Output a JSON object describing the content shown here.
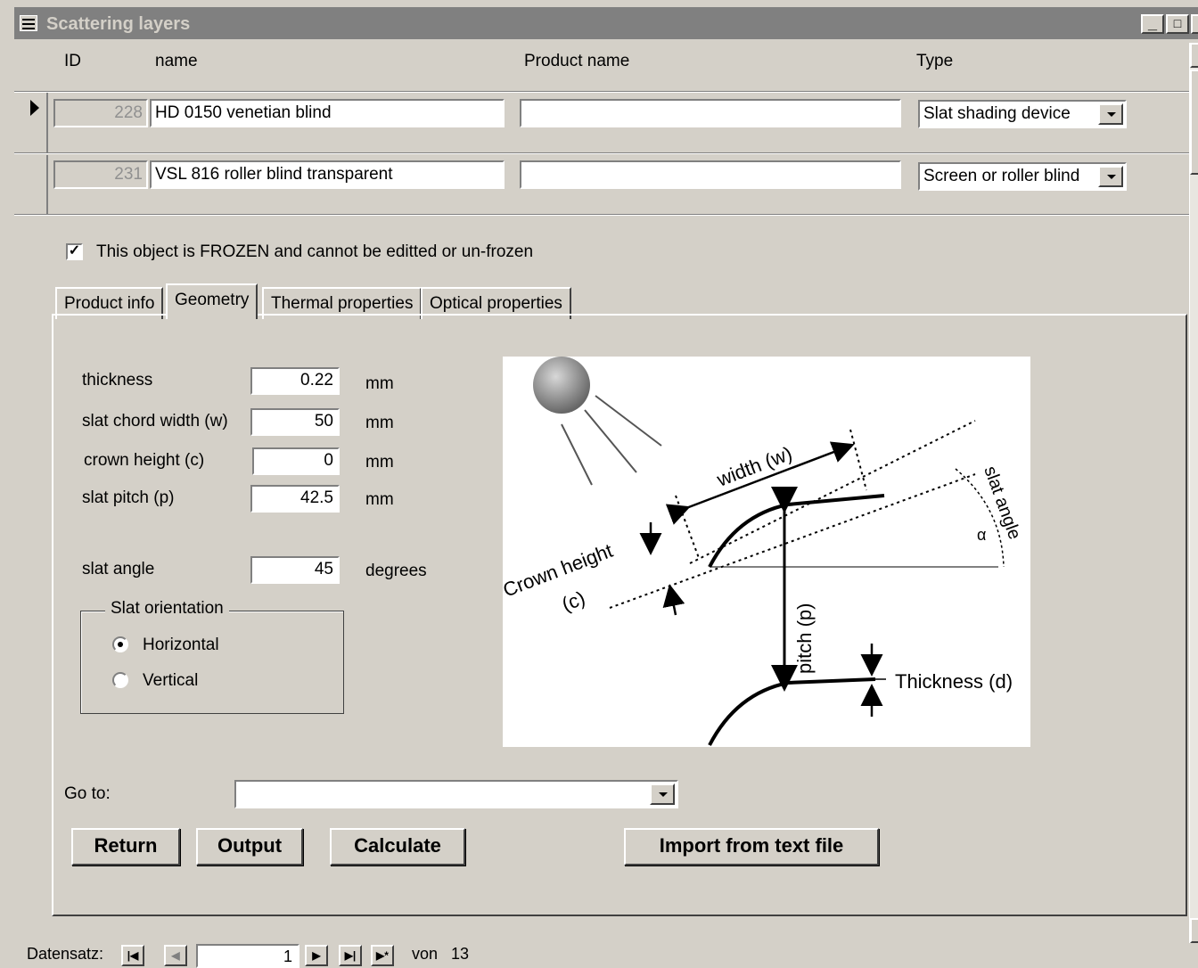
{
  "window": {
    "title": "Scattering layers",
    "minimize": "_",
    "maximize": "□",
    "close": "✕"
  },
  "columns": {
    "id": "ID",
    "name": "name",
    "product": "Product name",
    "type": "Type"
  },
  "records": [
    {
      "id": "228",
      "name": "HD 0150 venetian blind",
      "product": "",
      "type": "Slat shading device"
    },
    {
      "id": "231",
      "name": "VSL 816 roller blind transparent",
      "product": "",
      "type": "Screen or roller blind"
    }
  ],
  "frozen": {
    "checked": true,
    "label": "This object is FROZEN and cannot be editted or un-frozen"
  },
  "tabs": [
    "Product info",
    "Geometry",
    "Thermal properties",
    "Optical properties"
  ],
  "active_tab": "Geometry",
  "geometry": {
    "thickness": {
      "label": "thickness",
      "value": "0.22",
      "unit": "mm"
    },
    "chord": {
      "label": "slat chord width (w)",
      "value": "50",
      "unit": "mm"
    },
    "crown": {
      "label": "crown height (c)",
      "value": "0",
      "unit": "mm"
    },
    "pitch": {
      "label": "slat pitch (p)",
      "value": "42.5",
      "unit": "mm"
    },
    "angle": {
      "label": "slat angle",
      "value": "45",
      "unit": "degrees"
    }
  },
  "orientation": {
    "title": "Slat orientation",
    "options": [
      "Horizontal",
      "Vertical"
    ],
    "selected": "Horizontal"
  },
  "diagram": {
    "width": "width (w)",
    "crown": "Crown height",
    "crown_c": "(c)",
    "pitch": "pitch (p)",
    "thickness": "Thickness (d)",
    "angle": "slat angle",
    "alpha": "α"
  },
  "goto": {
    "label": "Go to:",
    "value": ""
  },
  "buttons": {
    "return": "Return",
    "output": "Output",
    "calculate": "Calculate",
    "import": "Import from text file"
  },
  "nav": {
    "label": "Datensatz:",
    "current": "1",
    "of": "von",
    "total": "13"
  }
}
